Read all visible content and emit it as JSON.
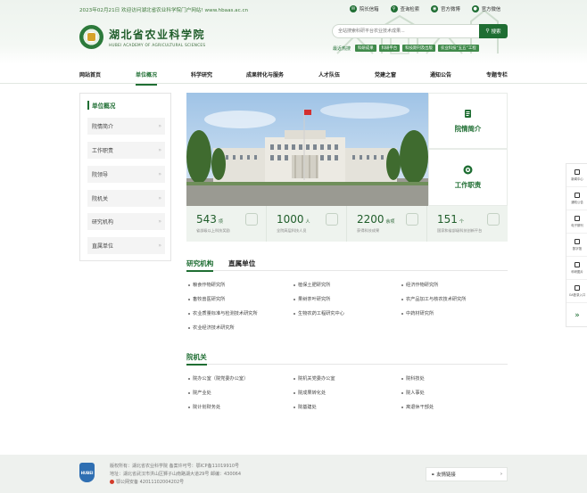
{
  "header": {
    "welcome": "2023年02月21日 欢迎访问湖北省农业科学院门户网站! www.hbaas.ac.cn",
    "top_links": [
      {
        "icon": "mail-icon",
        "label": "院长信箱"
      },
      {
        "icon": "search-icon",
        "label": "查询检索"
      },
      {
        "icon": "weibo-icon",
        "label": "官方微博"
      },
      {
        "icon": "wechat-icon",
        "label": "官方微信"
      }
    ],
    "logo_cn": "湖北省农业科学院",
    "logo_en": "HUBEI ACADEMY OF AGRICULTURAL SCIENCES",
    "search_placeholder": "全站搜索科研平台农业技术成果...",
    "search_button": "搜索",
    "hot_label": "最近热搜",
    "hot_tags": [
      "科研成果",
      "科研平台",
      "科技期刊及出版",
      "农业科技“五五”工程"
    ]
  },
  "nav": [
    "网站首页",
    "单位概况",
    "科学研究",
    "成果转化与服务",
    "人才队伍",
    "党建之窗",
    "通知公告",
    "专题专栏"
  ],
  "side": {
    "title": "单位概况",
    "items": [
      "院情简介",
      "工作职责",
      "院领导",
      "院机关",
      "研究机构",
      "直属单位"
    ],
    "arrow": "»"
  },
  "cards": [
    {
      "icon": "document-icon",
      "label": "院情简介"
    },
    {
      "icon": "target-icon",
      "label": "工作职责"
    }
  ],
  "stats": [
    {
      "num": "543",
      "unit": "项",
      "cap": "省部级以上科技奖励"
    },
    {
      "num": "1000",
      "unit": "人",
      "cap": "全院高层科技人员"
    },
    {
      "num": "2200",
      "unit": "余项",
      "cap": "获得科技成果"
    },
    {
      "num": "151",
      "unit": "个",
      "cap": "国家和省部级科技创新平台"
    }
  ],
  "tabs": [
    "研究机构",
    "直属单位"
  ],
  "institutes": [
    "粮食作物研究所",
    "植保土肥研究所",
    "经济作物研究所",
    "畜牧兽医研究所",
    "果树茶叶研究所",
    "农产品加工与核农技术研究所",
    "农业质量标准与检测技术研究所",
    "生物农药工程研究中心",
    "中药材研究所",
    "农业经济技术研究所"
  ],
  "section2": "院机关",
  "offices": [
    "院办公室（院党委办公室）",
    "院机关党委办公室",
    "院科技处",
    "院产业处",
    "院成果转化处",
    "院人事处",
    "院计划财务处",
    "院基建处",
    "离退休干部处"
  ],
  "float": [
    "新闻中心",
    "通知公告",
    "电子期刊",
    "数字馆",
    "科研图片",
    "OA登录入口"
  ],
  "footer": {
    "line1": "版权所有：湖北省农业科学院   备案许可号：鄂ICP备11019910号",
    "line2": "地址：湖北省武汉市洪山区狮子山南路湖大道29号   邮编：430064",
    "line3": "鄂公网安备 42011102004202号",
    "emblem": "HUBEI",
    "friends": "友情链接",
    "friends_arrow": "›"
  },
  "colors": {
    "primary": "#1f6e33",
    "accent": "#3f8a4a",
    "footer_bg": "#eef1ee"
  }
}
